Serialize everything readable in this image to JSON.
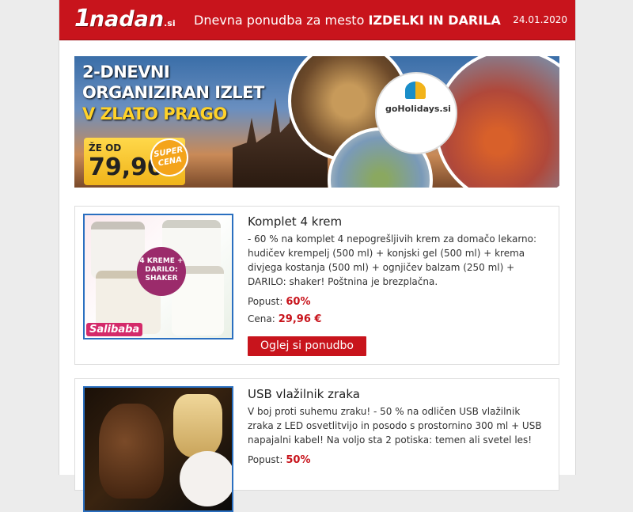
{
  "header": {
    "logo_one": "1",
    "logo_nadan": "nadan",
    "logo_tld": ".si",
    "title_prefix": "Dnevna ponudba za mesto",
    "title_city": "IZDELKI IN DARILA",
    "date": "24.01.2020"
  },
  "banner": {
    "line1": "2-DNEVNI",
    "line2": "ORGANIZIRAN IZLET",
    "line3_prefix": "V",
    "line3_gold": "ZLATO PRAGO",
    "price_label": "ŽE OD",
    "price_value": "79,90€",
    "super_badge": "SUPER CENA",
    "partner_logo": "goHolidays.si"
  },
  "offers": [
    {
      "title": "Komplet 4 krem",
      "description": "- 60 % na komplet 4 nepogrešljivih krem za domačo lekarno: hudičev krempelj (500 ml) + konjski gel (500 ml) + krema divjega kostanja (500 ml) + ognjičev balzam (250 ml) + DARILO: shaker! Poštnina je brezplačna.",
      "discount_label": "Popust:",
      "discount_value": "60%",
      "price_label": "Cena:",
      "price_value": "29,96 €",
      "button_label": "Oglej si ponudbo",
      "thumb_badge": "4 KREME + DARILO: SHAKER",
      "thumb_shop": "Salibaba"
    },
    {
      "title": "USB vlažilnik zraka",
      "description": "V boj proti suhemu zraku! - 50 % na odličen USB vlažilnik zraka z LED osvetlitvijo in posodo s prostornino 300 ml + USB napajalni kabel! Na voljo sta 2 potiska: temen ali svetel les!",
      "discount_label": "Popust:",
      "discount_value": "50%"
    }
  ],
  "colors": {
    "brand_red": "#c8141c",
    "thumb_border": "#2a6fc0",
    "gold": "#ffd229"
  }
}
